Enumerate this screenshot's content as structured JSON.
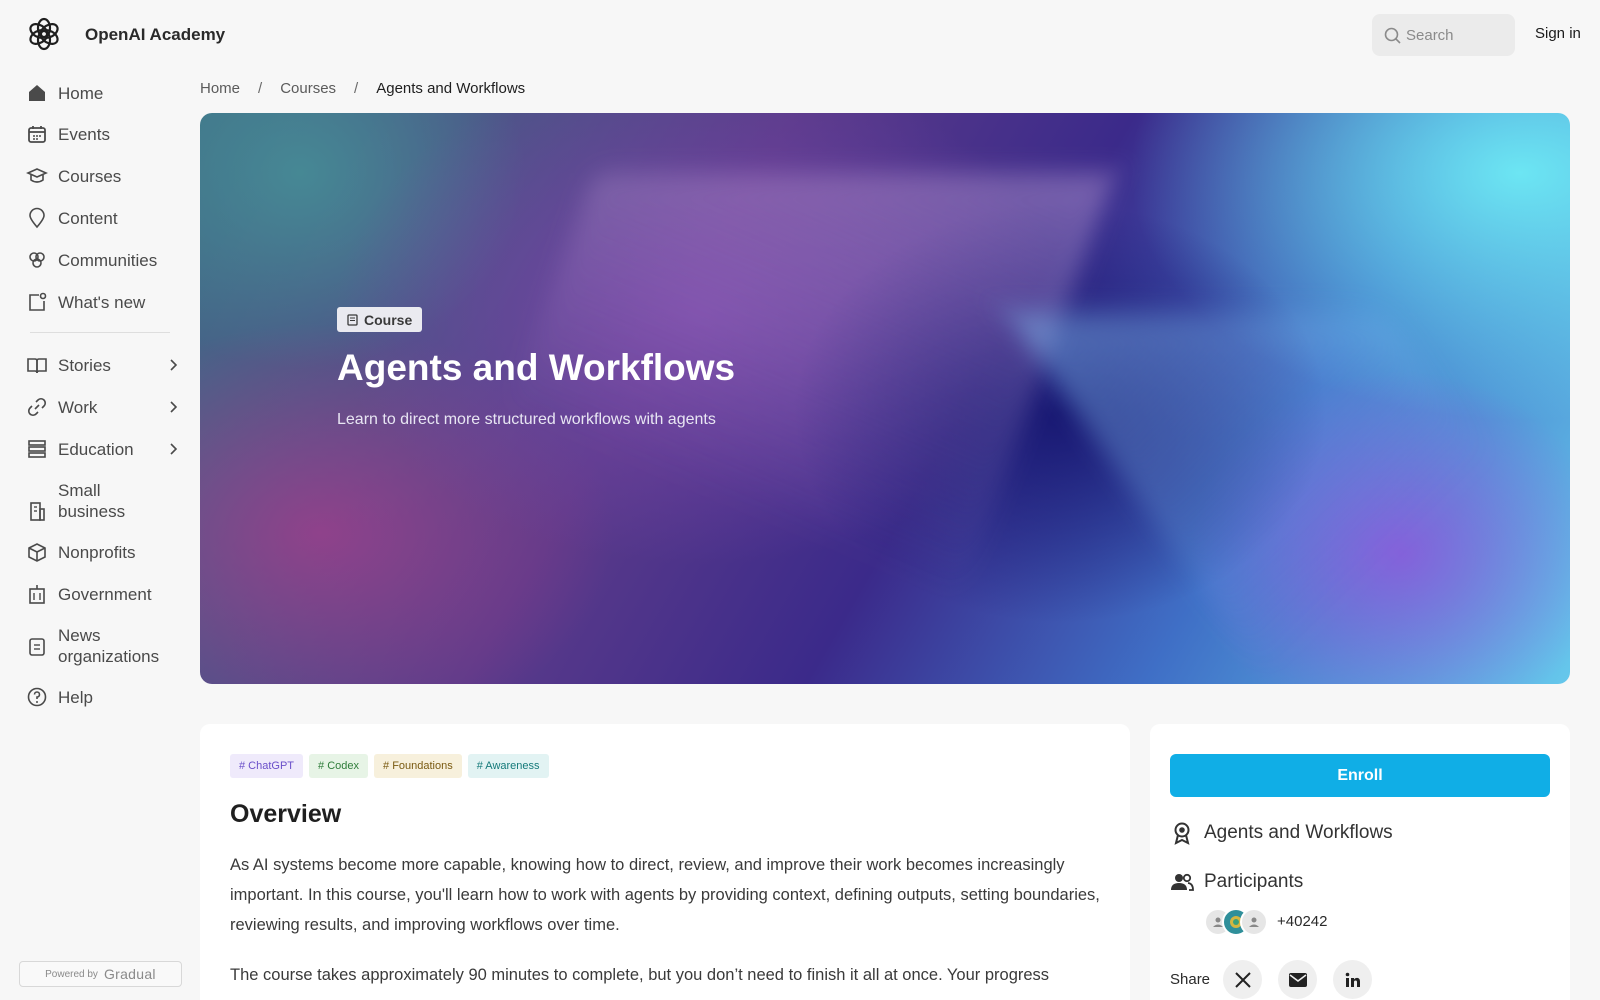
{
  "header": {
    "brand": "OpenAI Academy",
    "search_placeholder": "Search",
    "sign_in": "Sign in"
  },
  "sidebar": {
    "items": [
      {
        "label": "Home",
        "icon": "home-icon"
      },
      {
        "label": "Events",
        "icon": "calendar-icon"
      },
      {
        "label": "Courses",
        "icon": "graduation-cap-icon"
      },
      {
        "label": "Content",
        "icon": "map-pin-icon"
      },
      {
        "label": "Communities",
        "icon": "communities-icon"
      },
      {
        "label": "What's new",
        "icon": "new-item-icon"
      }
    ],
    "groups": [
      {
        "label": "Stories",
        "icon": "book-icon"
      },
      {
        "label": "Work",
        "icon": "link-icon"
      },
      {
        "label": "Education",
        "icon": "education-icon"
      }
    ],
    "links": [
      {
        "label": "Small business",
        "icon": "building-icon"
      },
      {
        "label": "Nonprofits",
        "icon": "box-icon"
      },
      {
        "label": "Government",
        "icon": "government-icon"
      },
      {
        "label": "News organizations",
        "icon": "clipboard-icon"
      },
      {
        "label": "Help",
        "icon": "help-icon"
      }
    ],
    "powered_by": "Powered by",
    "powered_brand": "Gradual"
  },
  "breadcrumb": {
    "items": [
      "Home",
      "Courses"
    ],
    "separator": "/",
    "current": "Agents and Workflows"
  },
  "hero": {
    "badge": "Course",
    "title": "Agents and Workflows",
    "subtitle": "Learn to direct more structured workflows with agents"
  },
  "main": {
    "tags": [
      {
        "label": "# ChatGPT",
        "color": "#6a4fc9",
        "bg": "#efeafb"
      },
      {
        "label": "# Codex",
        "color": "#2f7d3a",
        "bg": "#e7f4e6"
      },
      {
        "label": "# Foundations",
        "color": "#7a5a11",
        "bg": "#f7f0dc"
      },
      {
        "label": "# Awareness",
        "color": "#157a7a",
        "bg": "#e2f3f3"
      }
    ],
    "overview_title": "Overview",
    "paragraphs": [
      "As AI systems become more capable, knowing how to direct, review, and improve their work becomes increasingly important. In this course, you'll learn how to work with agents by providing context, defining outputs, setting boundaries, reviewing results, and improving workflows over time.",
      "The course takes approximately 90 minutes to complete, but you don’t need to finish it all at once. Your progress"
    ]
  },
  "side": {
    "enroll": "Enroll",
    "course_name": "Agents and Workflows",
    "participants_label": "Participants",
    "participants_count": "+40242",
    "share_label": "Share",
    "share_icons": [
      "x-icon",
      "mail-icon",
      "linkedin-icon"
    ],
    "accent": "#10aee6"
  }
}
